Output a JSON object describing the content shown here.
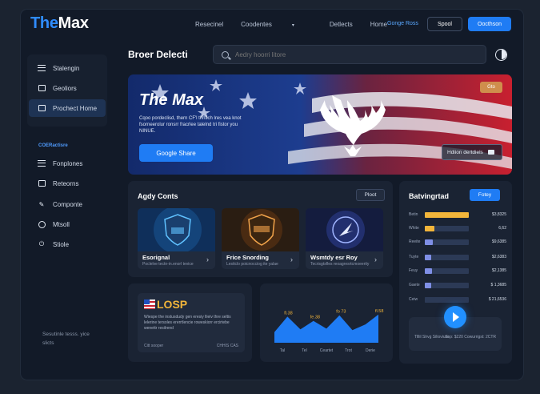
{
  "app": {
    "logo_part1": "The",
    "logo_part2": "Max"
  },
  "nav": {
    "items": [
      "Resecinel",
      "Coodentes",
      "Detlects",
      "Home"
    ],
    "link": "Gonge Ross",
    "btn_outline": "Spool",
    "btn_primary": "Oocthson"
  },
  "sidebar": {
    "items": [
      {
        "label": "Stalengin",
        "icon": "list-icon"
      },
      {
        "label": "Geoliors",
        "icon": "grid-icon"
      },
      {
        "label": "Prochect Home",
        "icon": "checkbox-icon",
        "active": true
      }
    ],
    "section_label": "COERactisre",
    "items2": [
      {
        "label": "Fonplones",
        "icon": "list-icon"
      },
      {
        "label": "Reteorns",
        "icon": "box-icon"
      },
      {
        "label": "Componte",
        "icon": "brush-icon"
      },
      {
        "label": "Mtsoll",
        "icon": "circle-icon"
      },
      {
        "label": "Stiole",
        "icon": "power-icon"
      }
    ],
    "footer": "Sesutinle tesss. yice slicts"
  },
  "header": {
    "title": "Broer Delecti",
    "search_placeholder": "Aedry hoorri litore"
  },
  "hero": {
    "title": "The Max",
    "description": "Cqoo pordeclisd, thern CF'l thrltich lres vea knot fsorneerolur ronsrr fracrlee talelnd tri fistor you NINUE.",
    "button": "Google Share",
    "badge": "Gto",
    "tag": "Hdiion dertdiels"
  },
  "cards_panel": {
    "title": "Agdy Conts",
    "chip": "Ploot",
    "cards": [
      {
        "title": "Esorignal",
        "subtitle": "Poclelve tectn-in.enorl tevice"
      },
      {
        "title": "Frice Snording",
        "subtitle": "Lesticlo poicnocciog ite yalae"
      },
      {
        "title": "Wsmtdy esr Roy",
        "subtitle": "Tecrisgtsfles reoagresrtcmoeerity"
      }
    ]
  },
  "leaderboard": {
    "title": "Batvingrtad",
    "chip": "Fotey",
    "rows": [
      {
        "label": "Betin",
        "value": "$3,8325",
        "fill": 1.0,
        "color": "#f2b53a"
      },
      {
        "label": "White",
        "value": "6,62",
        "fill": 0.22,
        "color": "#f2b53a"
      },
      {
        "label": "Reeite",
        "value": "$9,6385",
        "fill": 0.18,
        "color": "#7f8fe6"
      },
      {
        "label": "Tuyte",
        "value": "$2,6383",
        "fill": 0.14,
        "color": "#7f8fe6"
      },
      {
        "label": "Feuy",
        "value": "$2,1385",
        "fill": 0.16,
        "color": "#7f8fe6"
      },
      {
        "label": "Gaete",
        "value": "$ 1,3685",
        "fill": 0.14,
        "color": "#7f8fe6"
      },
      {
        "label": "Ceiw",
        "value": "$ 21,6536",
        "fill": 0.44,
        "color": "#2c3a56"
      }
    ],
    "player_left": "Tlllil Slrvg Silioviure",
    "player_right": "Ssp: $220 Cowurrigst: 2CTR"
  },
  "losp": {
    "title": "LOSP",
    "description": "Wiespe the instusdudy gen eresiy llieiv thre seltis lelerine tersoles ererrtlencie roweskiorr ercirtebe wenettr resilrend",
    "footer_left": "Citt sooper",
    "footer_right": "CHHIS CAS"
  },
  "chart_data": {
    "type": "area",
    "x": [
      "Tal",
      "Tel",
      "Ceartet",
      "Trot",
      "Derie"
    ],
    "values": [
      30,
      74,
      38,
      62,
      40,
      78,
      36,
      52,
      80
    ],
    "peak_labels": [
      "fl.38",
      "fe.38",
      "fo 73",
      "fl.58"
    ],
    "colors": {
      "area": "#1f7cf4"
    }
  }
}
